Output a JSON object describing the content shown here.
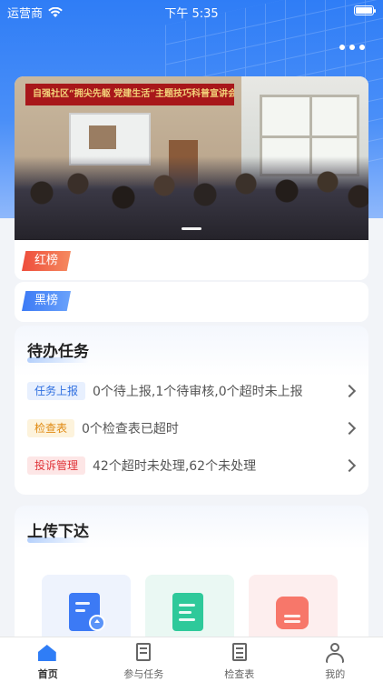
{
  "statusbar": {
    "carrier": "运营商",
    "time": "下午 5:35"
  },
  "header": {
    "more_icon": "more-dots-icon"
  },
  "banner": {
    "sign_text": "自强社区“拥尖先躯 党建生活”主题技巧科普宣讲会",
    "page_count": 1,
    "active_page": 1
  },
  "rankings": {
    "red_label": "红榜",
    "black_label": "黑榜"
  },
  "todo": {
    "title": "待办任务",
    "items": [
      {
        "tag": "任务上报",
        "text": "0个待上报,1个待审核,0个超时未上报",
        "tag_color": "#2f6fe0"
      },
      {
        "tag": "检查表",
        "text": "0个检查表已超时",
        "tag_color": "#e08a12"
      },
      {
        "tag": "投诉管理",
        "text": "42个超时未处理,62个未处理",
        "tag_color": "#e0353a"
      }
    ]
  },
  "upload": {
    "title": "上传下达",
    "tiles": [
      {
        "icon": "upload-document-icon",
        "color": "#3c7af5"
      },
      {
        "icon": "document-list-icon",
        "color": "#2ec99a"
      },
      {
        "icon": "upload-tray-icon",
        "color": "#f7776a"
      }
    ]
  },
  "tabbar": {
    "items": [
      {
        "label": "首页",
        "icon": "home-icon",
        "active": true
      },
      {
        "label": "参与任务",
        "icon": "task-participate-icon",
        "active": false
      },
      {
        "label": "检查表",
        "icon": "checklist-icon",
        "active": false
      },
      {
        "label": "我的",
        "icon": "user-icon",
        "active": false
      }
    ]
  },
  "colors": {
    "primary": "#2f7df6",
    "background": "#f2f4f8"
  }
}
